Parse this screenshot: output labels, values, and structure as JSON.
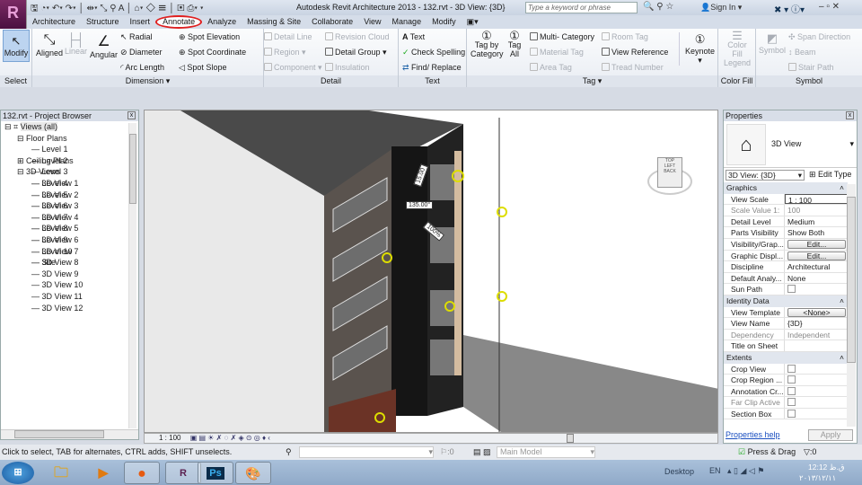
{
  "app": {
    "title": "Autodesk Revit Architecture 2013 -    132.rvt - 3D View: {3D}",
    "search_placeholder": "Type a keyword or phrase",
    "sign_in": "Sign In",
    "logo": "R"
  },
  "tabs": [
    "Architecture",
    "Structure",
    "Insert",
    "Annotate",
    "Analyze",
    "Massing & Site",
    "Collaborate",
    "View",
    "Manage",
    "Modify"
  ],
  "ribbon": {
    "select": {
      "label": "Select",
      "modify": "Modify"
    },
    "dimension": {
      "label": "Dimension ▾",
      "aligned": "Aligned",
      "linear": "Linear",
      "angular": "Angular",
      "radial": "Radial",
      "diameter": "Diameter",
      "arc_length": "Arc Length",
      "spot_elevation": "Spot Elevation",
      "spot_coordinate": "Spot Coordinate",
      "spot_slope": "Spot Slope"
    },
    "detail": {
      "label": "Detail",
      "detail_line": "Detail Line",
      "region": "Region ▾",
      "component": "Component ▾",
      "revision_cloud": "Revision Cloud",
      "detail_group": "Detail Group ▾",
      "insulation": "Insulation"
    },
    "text": {
      "label": "Text",
      "text": "Text",
      "check_spelling": "Check Spelling",
      "find_replace": "Find/ Replace"
    },
    "tag": {
      "label": "Tag ▾",
      "tag_by_category": "Tag by Category",
      "tag_all": "Tag All",
      "multi_category": "Multi- Category",
      "material_tag": "Material Tag",
      "area_tag": "Area Tag",
      "room_tag": "Room Tag",
      "view_reference": "View Reference",
      "tread_number": "Tread Number",
      "keynote": "Keynote"
    },
    "color_fill": {
      "label": "Color Fill",
      "legend": "Color Fill Legend"
    },
    "symbol": {
      "label": "Symbol",
      "symbol": "Symbol",
      "span_direction": "Span Direction",
      "beam": "Beam",
      "stair_path": "Stair Path"
    }
  },
  "browser": {
    "title": "132.rvt - Project Browser",
    "root": "Views (all)",
    "floor_plans": "Floor Plans",
    "levels": [
      "Level 1",
      "Level 2",
      "Level 3",
      "Level 4",
      "Level 5",
      "Level 6",
      "Level 7",
      "Level 8",
      "Level 9",
      "Level 10",
      "Site"
    ],
    "ceiling_plans": "Ceiling Plans",
    "views_3d": "3D Views",
    "views_3d_items": [
      "3D View 1",
      "3D View 2",
      "3D View 3",
      "3D View 4",
      "3D View 5",
      "3D View 6",
      "3D View 7",
      "3D View 8",
      "3D View 9",
      "3D View 10",
      "3D View 11",
      "3D View 12"
    ]
  },
  "viewport": {
    "scale": "1 : 100",
    "angle": "135.00°",
    "dim1": "15.00",
    "pct": "100%",
    "cube_top": "TOP",
    "cube_left": "LEFT",
    "cube_back": "BACK"
  },
  "properties": {
    "title": "Properties",
    "type_name": "3D View",
    "selector": "3D View: {3D}",
    "edit_type": "Edit Type",
    "groups": [
      {
        "name": "Graphics",
        "rows": [
          [
            "View Scale",
            "1 : 100"
          ],
          [
            "Scale Value    1:",
            "100"
          ],
          [
            "Detail Level",
            "Medium"
          ],
          [
            "Parts Visibility",
            "Show Both"
          ],
          [
            "Visibility/Grap...",
            "Edit..."
          ],
          [
            "Graphic Displ...",
            "Edit..."
          ],
          [
            "Discipline",
            "Architectural"
          ],
          [
            "Default Analy...",
            "None"
          ],
          [
            "Sun Path",
            ""
          ]
        ]
      },
      {
        "name": "Identity Data",
        "rows": [
          [
            "View Template",
            "<None>"
          ],
          [
            "View Name",
            "{3D}"
          ],
          [
            "Dependency",
            "Independent"
          ],
          [
            "Title on Sheet",
            ""
          ]
        ]
      },
      {
        "name": "Extents",
        "rows": [
          [
            "Crop View",
            ""
          ],
          [
            "Crop Region ...",
            ""
          ],
          [
            "Annotation Cr...",
            ""
          ],
          [
            "Far Clip Active",
            ""
          ],
          [
            "Section Box",
            ""
          ]
        ]
      }
    ],
    "help": "Properties help",
    "apply": "Apply"
  },
  "status": {
    "message": "Click to select, TAB for alternates, CTRL adds, SHIFT unselects.",
    "count1": ":0",
    "model": "Main Model",
    "press_drag": "Press & Drag",
    "filter": ":0"
  },
  "taskbar": {
    "desktop": "Desktop",
    "lang": "EN",
    "time": "12:12 ق.ظ",
    "date": "۲۰۱۳/۱۲/۱۱",
    "ps": "Ps"
  }
}
